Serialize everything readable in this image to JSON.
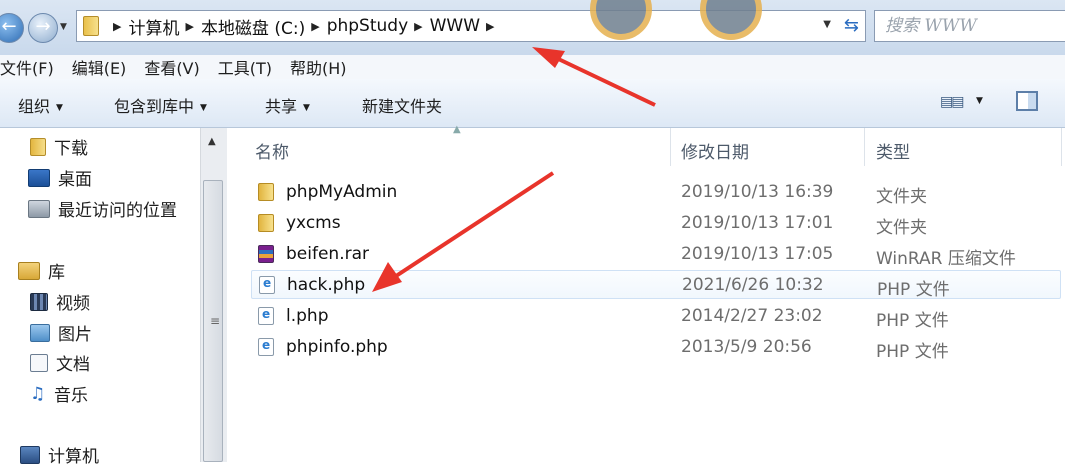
{
  "address_bar": {
    "breadcrumbs": [
      "计算机",
      "本地磁盘 (C:)",
      "phpStudy",
      "WWW"
    ]
  },
  "search": {
    "placeholder": "搜索 WWW"
  },
  "menu": [
    "文件(F)",
    "编辑(E)",
    "查看(V)",
    "工具(T)",
    "帮助(H)"
  ],
  "toolbar": {
    "organize": "组织",
    "include_in_library": "包含到库中",
    "share": "共享",
    "new_folder": "新建文件夹"
  },
  "sidebar": {
    "items": [
      {
        "label": "下载",
        "icon": "downloads-folder-icon"
      },
      {
        "label": "桌面",
        "icon": "desktop-icon"
      },
      {
        "label": "最近访问的位置",
        "icon": "recent-places-icon"
      },
      {
        "label": "库",
        "icon": "library-icon"
      },
      {
        "label": "视频",
        "icon": "videos-icon"
      },
      {
        "label": "图片",
        "icon": "pictures-icon"
      },
      {
        "label": "文档",
        "icon": "documents-icon"
      },
      {
        "label": "音乐",
        "icon": "music-icon"
      },
      {
        "label": "计算机",
        "icon": "computer-icon"
      }
    ]
  },
  "columns": {
    "name": "名称",
    "modified": "修改日期",
    "type": "类型"
  },
  "files": [
    {
      "name": "phpMyAdmin",
      "date": "2019/10/13 16:39",
      "type": "文件夹",
      "icon": "folder-icon"
    },
    {
      "name": "yxcms",
      "date": "2019/10/13 17:01",
      "type": "文件夹",
      "icon": "folder-icon"
    },
    {
      "name": "beifen.rar",
      "date": "2019/10/13 17:05",
      "type": "WinRAR 压缩文件",
      "icon": "winrar-archive-icon"
    },
    {
      "name": "hack.php",
      "date": "2021/6/26 10:32",
      "type": "PHP 文件",
      "icon": "php-file-icon"
    },
    {
      "name": "l.php",
      "date": "2014/2/27 23:02",
      "type": "PHP 文件",
      "icon": "php-file-icon"
    },
    {
      "name": "phpinfo.php",
      "date": "2013/5/9 20:56",
      "type": "PHP 文件",
      "icon": "php-file-icon"
    }
  ],
  "colors": {
    "annotation_arrow": "#e8342b",
    "selection_border": "#cfe1f5"
  }
}
